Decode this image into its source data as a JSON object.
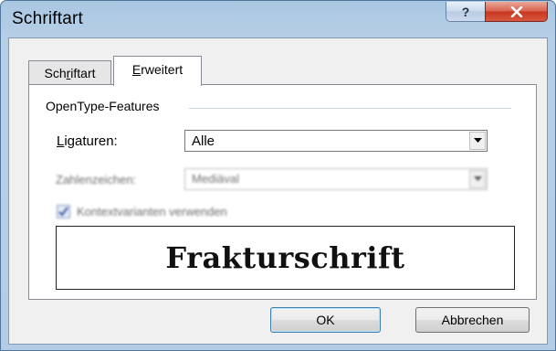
{
  "window": {
    "title": "Schriftart"
  },
  "titlebar": {
    "help_glyph": "?",
    "close_glyph": "X"
  },
  "tabs": [
    {
      "label": "Schriftart",
      "mnemonic_index": 2,
      "selected": false
    },
    {
      "label": "Erweitert",
      "mnemonic_index": 0,
      "selected": true
    }
  ],
  "opentype": {
    "group_label": "OpenType-Features",
    "ligaturen": {
      "label": "Ligaturen:",
      "value": "Alle"
    },
    "zahlenzeichen": {
      "label": "Zahlenzeichen:",
      "value": "Mediäval",
      "disabled": true
    },
    "kontextvarianten": {
      "label": "Kontextvarianten verwenden",
      "checked": true,
      "disabled": true
    }
  },
  "preview": {
    "text": "Frakturschrift"
  },
  "buttons": {
    "ok": "OK",
    "cancel": "Abbrechen"
  },
  "colors": {
    "titlebar": "#b4cde5",
    "client": "#f0f0f0",
    "close_button": "#c7361f",
    "ok_border": "#3c7fb1"
  }
}
